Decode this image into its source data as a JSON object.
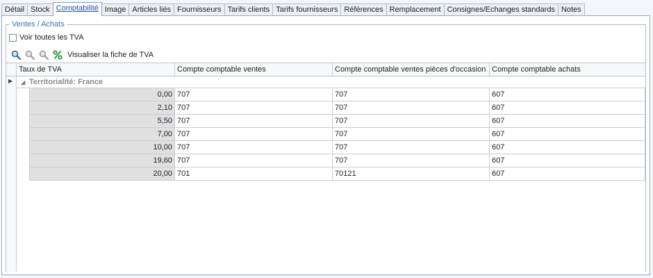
{
  "tabs": [
    {
      "label": "Détail",
      "active": false
    },
    {
      "label": "Stock",
      "active": false
    },
    {
      "label": "Comptabilité",
      "active": true
    },
    {
      "label": "Image",
      "active": false
    },
    {
      "label": "Articles liés",
      "active": false
    },
    {
      "label": "Fournisseurs",
      "active": false
    },
    {
      "label": "Tarifs clients",
      "active": false
    },
    {
      "label": "Tarifs fournisseurs",
      "active": false
    },
    {
      "label": "Références",
      "active": false
    },
    {
      "label": "Remplacement",
      "active": false
    },
    {
      "label": "Consignes/Echanges standards",
      "active": false
    },
    {
      "label": "Notes",
      "active": false
    }
  ],
  "group": {
    "title": "Ventes / Achats",
    "show_all_vat_label": "Voir toutes les TVA",
    "show_all_vat_checked": false
  },
  "toolbar": {
    "view_vat_label": "Visualiser la fiche de TVA",
    "icons": [
      "zoom-icon",
      "zoom-disabled-icon",
      "zoom-disabled-icon",
      "percent-icon"
    ]
  },
  "grid": {
    "columns": [
      "Taux de TVA",
      "Compte comptable ventes",
      "Compte comptable ventes pièces d'occasion",
      "Compte comptable achats"
    ],
    "group_label": "Territorialité: France",
    "rows": [
      {
        "rate": "0,00",
        "sales": "707",
        "used_parts": "707",
        "purchases": "607"
      },
      {
        "rate": "2,10",
        "sales": "707",
        "used_parts": "707",
        "purchases": "607"
      },
      {
        "rate": "5,50",
        "sales": "707",
        "used_parts": "707",
        "purchases": "607"
      },
      {
        "rate": "7,00",
        "sales": "707",
        "used_parts": "707",
        "purchases": "607"
      },
      {
        "rate": "10,00",
        "sales": "707",
        "used_parts": "707",
        "purchases": "607"
      },
      {
        "rate": "19,60",
        "sales": "707",
        "used_parts": "707",
        "purchases": "607"
      },
      {
        "rate": "20,00",
        "sales": "701",
        "used_parts": "70121",
        "purchases": "607"
      }
    ]
  },
  "colors": {
    "accent": "#3a6fb8",
    "active_tab_text": "#1f4fa0",
    "rate_cell_bg": "#e0e0e0",
    "percent_icon": "#2e9a3a"
  }
}
